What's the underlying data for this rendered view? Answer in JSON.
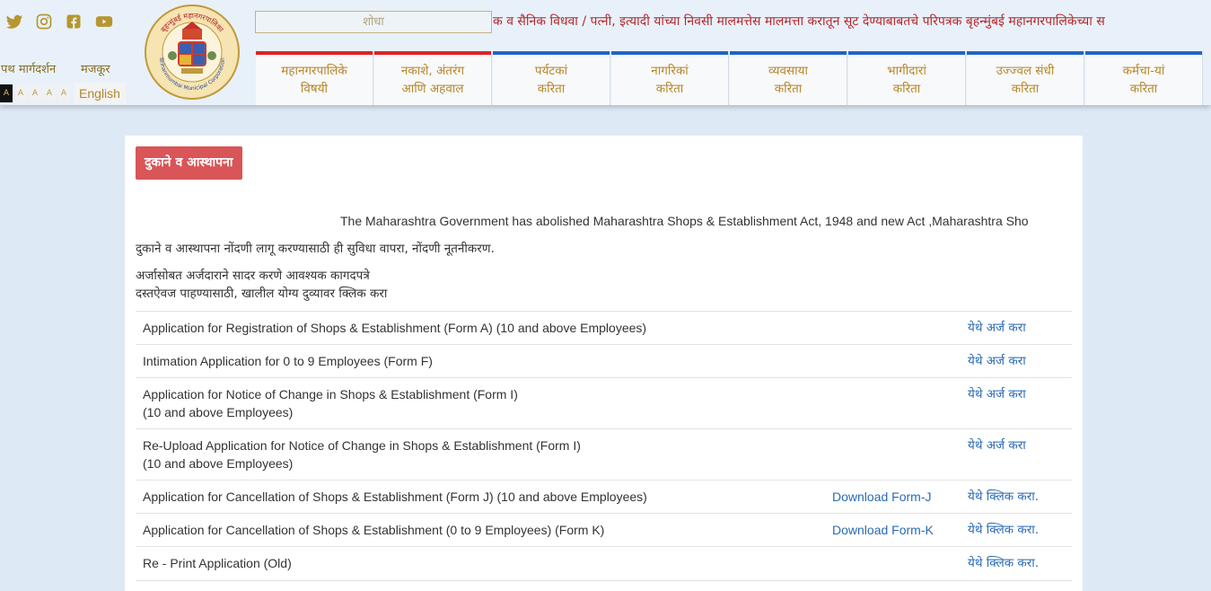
{
  "header": {
    "search_placeholder": "शोधा",
    "ticker_text": "क व सैनिक विधवा / पत्नी, इत्यादी यांच्या निवसी मालमत्तेस मालमत्ता करातून सूट देण्याबाबतचे परिपत्रक बृहन्मुंबई महानगरपालिकेच्या स",
    "utility_links": [
      "पथ मार्गदर्शन",
      "मजकूर"
    ],
    "font_sizes": [
      "A",
      "A",
      "A",
      "A",
      "A"
    ],
    "language_toggle": "English",
    "logo_top_text": "बृहन्मुंबई महानगरपालिका",
    "logo_bottom_text": "Brihanmumbai Municipal Corporation",
    "social_icons": [
      "twitter-icon",
      "instagram-icon",
      "facebook-icon",
      "youtube-icon"
    ]
  },
  "nav": {
    "items": [
      {
        "line1": "महानगरपालिके",
        "line2": "विषयी",
        "bar": "#e02127"
      },
      {
        "line1": "नकाशे, अंतरंग",
        "line2": "आणि अहवाल",
        "bar": "#e02127"
      },
      {
        "line1": "पर्यटकां",
        "line2": "करिता",
        "bar": "#1e66c9"
      },
      {
        "line1": "नागरिकां",
        "line2": "करिता",
        "bar": "#1e66c9"
      },
      {
        "line1": "व्यवसाया",
        "line2": "करिता",
        "bar": "#1e66c9"
      },
      {
        "line1": "भागीदारां",
        "line2": "करिता",
        "bar": "#1e66c9"
      },
      {
        "line1": "उज्ज्वल संधी",
        "line2": "करिता",
        "bar": "#1e66c9"
      },
      {
        "line1": "कर्मचा-यां",
        "line2": "करिता",
        "bar": "#1e66c9"
      }
    ]
  },
  "content": {
    "page_title": "दुकाने व आस्थापना",
    "intro": "The Maharashtra Government has abolished Maharashtra Shops & Establishment Act, 1948 and new Act ,Maharashtra Sho",
    "instruction": "दुकाने व आस्थापना नोंदणी लागू करण्यासाठी ही सुविधा वापरा, नोंदणी नूतनीकरण.",
    "docs_line1": "अर्जासोबत अर्जदाराने सादर करणे आवश्यक कागदपत्रे",
    "docs_line2": "दस्तऐवज पाहण्यासाठी, खालील योग्य दुव्यावर क्लिक करा",
    "rows": [
      {
        "line1": "Application for Registration of Shops & Establishment (Form A) (10 and above Employees)",
        "line2": "",
        "download": "",
        "action": "येथे अर्ज करा"
      },
      {
        "line1": "Intimation Application for 0 to 9 Employees (Form F)",
        "line2": "",
        "download": "",
        "action": "येथे अर्ज करा"
      },
      {
        "line1": "Application for Notice of Change in Shops & Establishment (Form I)",
        "line2": "(10 and above Employees)",
        "download": "",
        "action": "येथे अर्ज करा"
      },
      {
        "line1": "Re-Upload Application for Notice of Change in Shops & Establishment (Form I)",
        "line2": "(10 and above Employees)",
        "download": "",
        "action": "येथे अर्ज करा"
      },
      {
        "line1": "Application for Cancellation of Shops & Establishment (Form J) (10 and above Employees)",
        "line2": "",
        "download": "Download Form-J",
        "action": "येथे क्लिक करा."
      },
      {
        "line1": "Application for Cancellation of Shops & Establishment (0 to 9 Employees) (Form K)",
        "line2": "",
        "download": "Download Form-K",
        "action": "येथे क्लिक करा."
      },
      {
        "line1": "Re - Print Application (Old)",
        "line2": "",
        "download": "",
        "action": "येथे क्लिक करा."
      }
    ]
  },
  "colors": {
    "accent_red": "#d95557",
    "link_blue": "#2a6ab5",
    "nav_text": "#b8862a",
    "ticker_red": "#b3262a"
  }
}
